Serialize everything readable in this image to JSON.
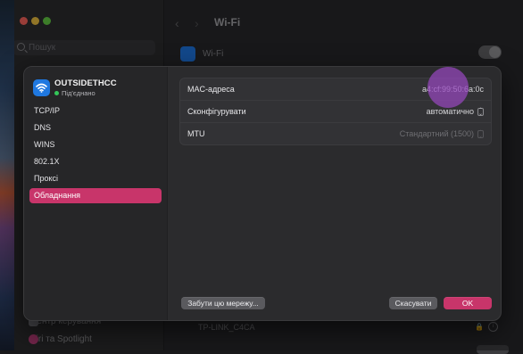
{
  "background": {
    "title": "Wi-Fi",
    "search_placeholder": "Пошук",
    "wifi_label": "Wi-Fi",
    "sidebar_items": [
      {
        "label": "Центр керування",
        "color": "#6b6b70"
      },
      {
        "label": "Siri та Spotlight",
        "color": "#b03a72"
      }
    ],
    "network_name": "TP-LINK_C4CA",
    "lock_glyph": "🔒",
    "info_glyph": "i"
  },
  "sheet": {
    "network": {
      "name": "OUTSIDETHCC",
      "status": "Під'єднано",
      "icon": "wifi-icon"
    },
    "menu": [
      {
        "label": "TCP/IP",
        "selected": false
      },
      {
        "label": "DNS",
        "selected": false
      },
      {
        "label": "WINS",
        "selected": false
      },
      {
        "label": "802.1X",
        "selected": false
      },
      {
        "label": "Проксі",
        "selected": false
      },
      {
        "label": "Обладнання",
        "selected": true
      }
    ],
    "settings": {
      "mac": {
        "label": "MAC-адреса",
        "value": "a4:cf:99:50:6a:0c"
      },
      "configure": {
        "label": "Сконфігурувати",
        "value": "автоматично"
      },
      "mtu": {
        "label": "MTU",
        "value": "Стандартний (1500)"
      }
    },
    "buttons": {
      "forget": "Забути цю мережу...",
      "cancel": "Скасувати",
      "ok": "OK"
    },
    "stepper_glyph": "⌃⌄"
  },
  "colors": {
    "accent": "#c8356a",
    "wifi_blue": "#1f78e0",
    "connected_green": "#34c759"
  }
}
